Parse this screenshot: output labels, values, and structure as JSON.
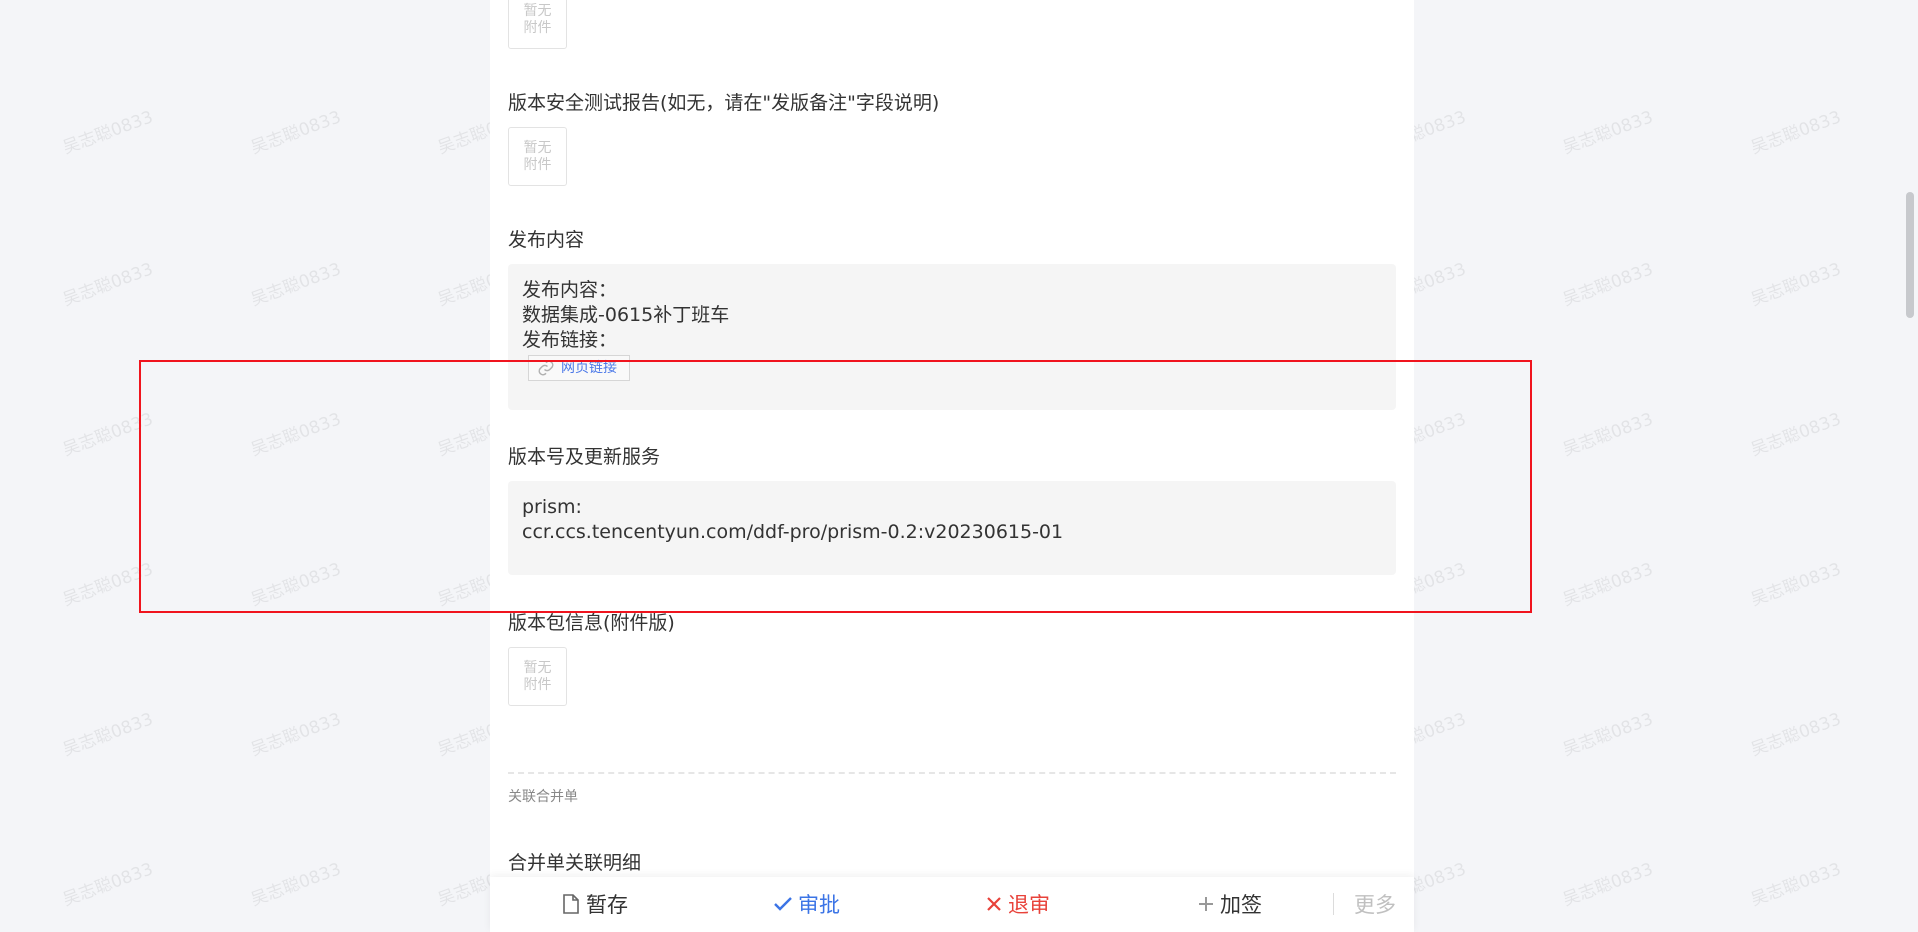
{
  "fields": {
    "attachment_top": {
      "empty_line1": "暂无",
      "empty_line2": "附件"
    },
    "security_report": {
      "label": "版本安全测试报告(如无，请在\"发版备注\"字段说明)",
      "empty_line1": "暂无",
      "empty_line2": "附件"
    },
    "release_content": {
      "label": "发布内容",
      "lines": [
        "发布内容：",
        "数据集成-0615补丁班车",
        "发布链接："
      ],
      "link_label": "网页链接"
    },
    "version_services": {
      "label": "版本号及更新服务",
      "lines": [
        "prism:",
        "ccr.ccs.tencentyun.com/ddf-pro/prism-0.2:v20230615-01"
      ]
    },
    "package_info": {
      "label": "版本包信息(附件版)",
      "empty_line1": "暂无",
      "empty_line2": "附件"
    }
  },
  "related": {
    "section_title": "关联合并单",
    "detail_label": "合并单关联明细"
  },
  "footer": {
    "save": "暂存",
    "approve": "审批",
    "reject": "退审",
    "add_sign": "加签",
    "more": "更多"
  },
  "watermark": "吴志聪0833",
  "colors": {
    "approve": "#3b74e6",
    "reject": "#e8423a",
    "highlight_box": "#f0141e"
  }
}
